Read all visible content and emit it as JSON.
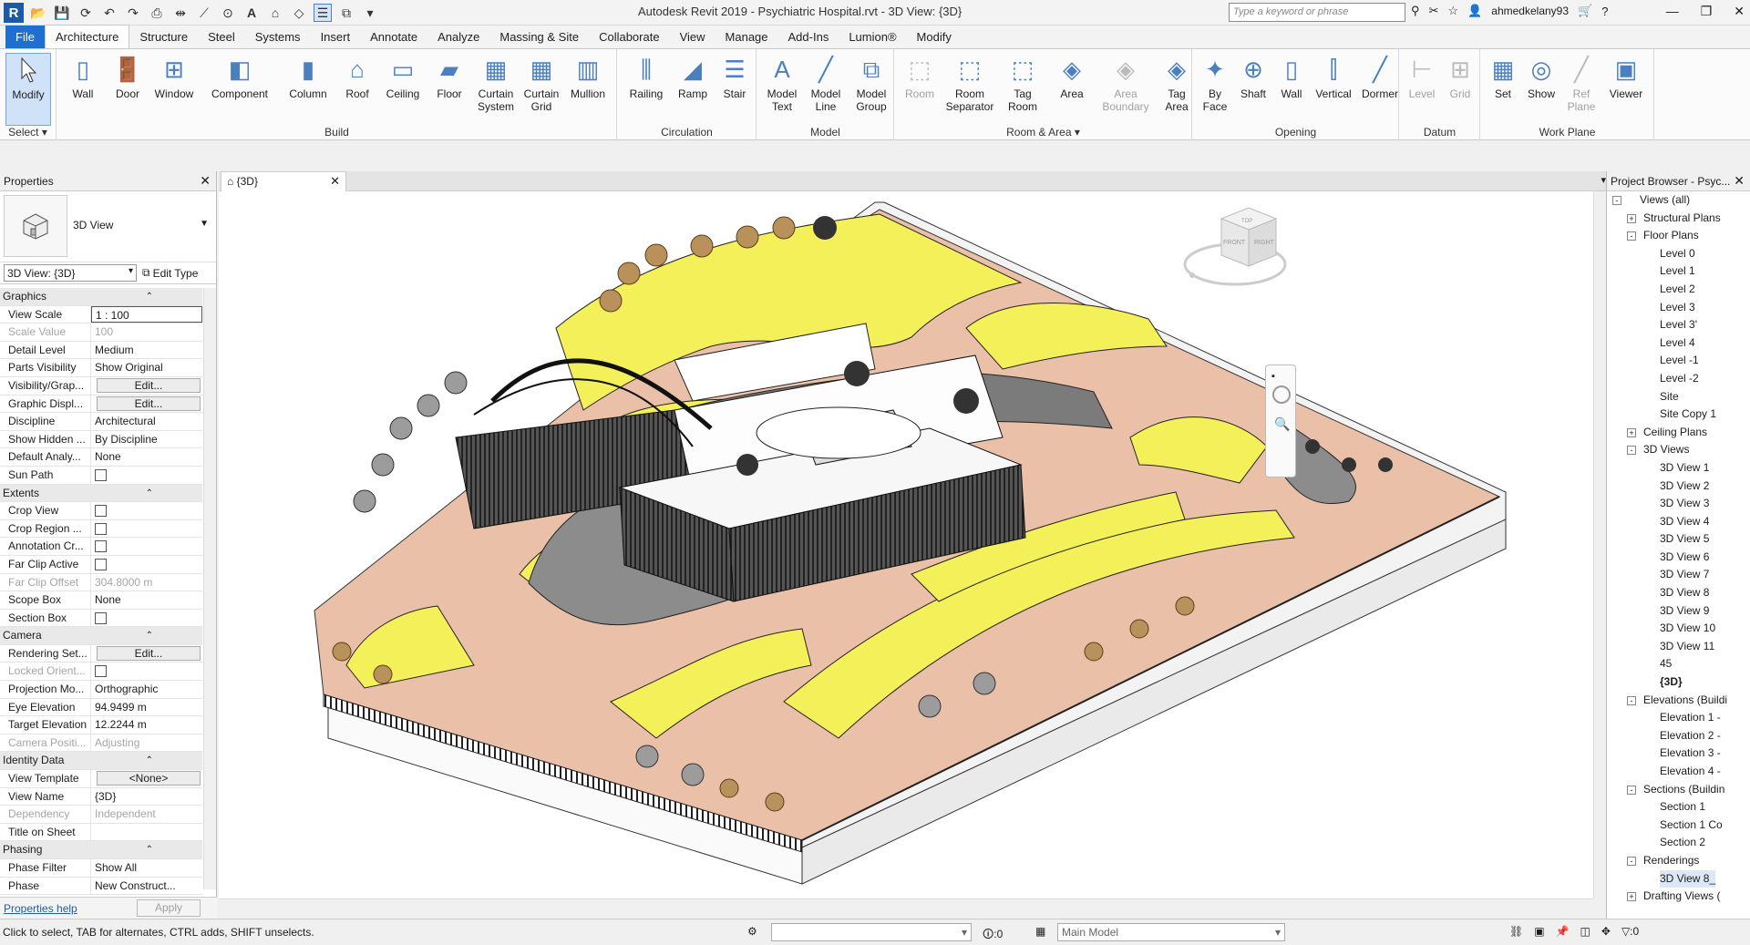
{
  "title": "Autodesk Revit 2019 - Psychiatric Hospital.rvt - 3D View: {3D}",
  "search_placeholder": "Type a keyword or phrase",
  "user": "ahmedkelany93",
  "tabs": [
    "File",
    "Architecture",
    "Structure",
    "Steel",
    "Systems",
    "Insert",
    "Annotate",
    "Analyze",
    "Massing & Site",
    "Collaborate",
    "View",
    "Manage",
    "Add-Ins",
    "Lumion®",
    "Modify"
  ],
  "ribbon": {
    "select_group": "Select",
    "modify": "Modify",
    "build_group": "Build",
    "build": [
      "Wall",
      "Door",
      "Window",
      "Component",
      "Column",
      "Roof",
      "Ceiling",
      "Floor",
      "Curtain\nSystem",
      "Curtain\nGrid",
      "Mullion"
    ],
    "circulation_group": "Circulation",
    "circulation": [
      "Railing",
      "Ramp",
      "Stair"
    ],
    "model_group": "Model",
    "model": [
      "Model\nText",
      "Model\nLine",
      "Model\nGroup"
    ],
    "room_group": "Room & Area",
    "room": [
      "Room",
      "Room\nSeparator",
      "Tag\nRoom",
      "Area",
      "Area\nBoundary",
      "Tag\nArea"
    ],
    "opening_group": "Opening",
    "opening": [
      "By\nFace",
      "Shaft",
      "Wall",
      "Vertical",
      "Dormer"
    ],
    "datum_group": "Datum",
    "datum": [
      "Level",
      "Grid"
    ],
    "workplane_group": "Work Plane",
    "workplane": [
      "Set",
      "Show",
      "Ref\nPlane",
      "Viewer"
    ]
  },
  "properties": {
    "title": "Properties",
    "type_name": "3D View",
    "view_selector": "3D View: {3D}",
    "edit_type": "Edit Type",
    "help": "Properties help",
    "apply": "Apply",
    "rows": [
      {
        "sect": "Graphics"
      },
      {
        "k": "View Scale",
        "v": "1 : 100",
        "input": true
      },
      {
        "k": "Scale Value",
        "v": "100",
        "extra": "1:",
        "dim": true
      },
      {
        "k": "Detail Level",
        "v": "Medium"
      },
      {
        "k": "Parts Visibility",
        "v": "Show Original"
      },
      {
        "k": "Visibility/Grap...",
        "btn": "Edit..."
      },
      {
        "k": "Graphic Displ...",
        "btn": "Edit..."
      },
      {
        "k": "Discipline",
        "v": "Architectural"
      },
      {
        "k": "Show Hidden ...",
        "v": "By Discipline"
      },
      {
        "k": "Default Analy...",
        "v": "None"
      },
      {
        "k": "Sun Path",
        "cb": true
      },
      {
        "sect": "Extents"
      },
      {
        "k": "Crop View",
        "cb": true
      },
      {
        "k": "Crop Region ...",
        "cb": true
      },
      {
        "k": "Annotation Cr...",
        "cb": true
      },
      {
        "k": "Far Clip Active",
        "cb": true
      },
      {
        "k": "Far Clip Offset",
        "v": "304.8000 m",
        "dim": true
      },
      {
        "k": "Scope Box",
        "v": "None"
      },
      {
        "k": "Section Box",
        "cb": true
      },
      {
        "sect": "Camera"
      },
      {
        "k": "Rendering Set...",
        "btn": "Edit..."
      },
      {
        "k": "Locked Orient...",
        "cb": true,
        "dim": true
      },
      {
        "k": "Projection Mo...",
        "v": "Orthographic"
      },
      {
        "k": "Eye Elevation",
        "v": "94.9499 m"
      },
      {
        "k": "Target Elevation",
        "v": "12.2244 m"
      },
      {
        "k": "Camera Positi...",
        "v": "Adjusting",
        "dim": true
      },
      {
        "sect": "Identity Data"
      },
      {
        "k": "View Template",
        "btn": "<None>"
      },
      {
        "k": "View Name",
        "v": "{3D}"
      },
      {
        "k": "Dependency",
        "v": "Independent",
        "dim": true
      },
      {
        "k": "Title on Sheet",
        "v": ""
      },
      {
        "sect": "Phasing"
      },
      {
        "k": "Phase Filter",
        "v": "Show All"
      },
      {
        "k": "Phase",
        "v": "New Construct..."
      }
    ]
  },
  "view_tab": "{3D}",
  "viewcube": {
    "top": "TOP",
    "front": "FRONT",
    "right": "RIGHT"
  },
  "browser": {
    "title": "Project Browser - Psyc...",
    "nodes": [
      {
        "t": "Views (all)",
        "l": 0,
        "tg": "-"
      },
      {
        "t": "Structural Plans",
        "l": 1,
        "tg": "+"
      },
      {
        "t": "Floor Plans",
        "l": 1,
        "tg": "-"
      },
      {
        "t": "Level 0",
        "l": 2
      },
      {
        "t": "Level 1",
        "l": 2
      },
      {
        "t": "Level 2",
        "l": 2
      },
      {
        "t": "Level 3",
        "l": 2
      },
      {
        "t": "Level 3'",
        "l": 2
      },
      {
        "t": "Level 4",
        "l": 2
      },
      {
        "t": "Level -1",
        "l": 2
      },
      {
        "t": "Level -2",
        "l": 2
      },
      {
        "t": "Site",
        "l": 2
      },
      {
        "t": "Site Copy 1",
        "l": 2
      },
      {
        "t": "Ceiling Plans",
        "l": 1,
        "tg": "+"
      },
      {
        "t": "3D Views",
        "l": 1,
        "tg": "-"
      },
      {
        "t": "3D View 1",
        "l": 2
      },
      {
        "t": "3D View 2",
        "l": 2
      },
      {
        "t": "3D View 3",
        "l": 2
      },
      {
        "t": "3D View 4",
        "l": 2
      },
      {
        "t": "3D View 5",
        "l": 2
      },
      {
        "t": "3D View 6",
        "l": 2
      },
      {
        "t": "3D View 7",
        "l": 2
      },
      {
        "t": "3D View 8",
        "l": 2
      },
      {
        "t": "3D View 9",
        "l": 2
      },
      {
        "t": "3D View 10",
        "l": 2
      },
      {
        "t": "3D View 11",
        "l": 2
      },
      {
        "t": "45",
        "l": 2
      },
      {
        "t": "{3D}",
        "l": 2,
        "bold": true
      },
      {
        "t": "Elevations (Buildi",
        "l": 1,
        "tg": "-"
      },
      {
        "t": "Elevation 1 -",
        "l": 2
      },
      {
        "t": "Elevation 2 -",
        "l": 2
      },
      {
        "t": "Elevation 3 -",
        "l": 2
      },
      {
        "t": "Elevation 4 -",
        "l": 2
      },
      {
        "t": "Sections (Buildin",
        "l": 1,
        "tg": "-"
      },
      {
        "t": "Section 1",
        "l": 2
      },
      {
        "t": "Section 1 Co",
        "l": 2
      },
      {
        "t": "Section 2",
        "l": 2
      },
      {
        "t": "Renderings",
        "l": 1,
        "tg": "-"
      },
      {
        "t": "3D View 8_",
        "l": 2,
        "sel": true
      },
      {
        "t": "Drafting Views (",
        "l": 1,
        "tg": "+"
      }
    ]
  },
  "status": {
    "message": "Click to select, TAB for alternates, CTRL adds, SHIFT unselects.",
    "coord": ":0",
    "model": "Main Model",
    "filter": ":0"
  }
}
